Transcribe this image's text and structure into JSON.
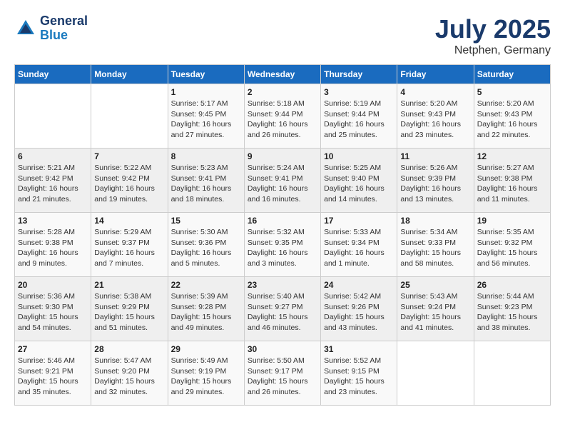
{
  "logo": {
    "line1": "General",
    "line2": "Blue"
  },
  "title": "July 2025",
  "subtitle": "Netphen, Germany",
  "days_header": [
    "Sunday",
    "Monday",
    "Tuesday",
    "Wednesday",
    "Thursday",
    "Friday",
    "Saturday"
  ],
  "weeks": [
    [
      {
        "day": "",
        "info": ""
      },
      {
        "day": "",
        "info": ""
      },
      {
        "day": "1",
        "info": "Sunrise: 5:17 AM\nSunset: 9:45 PM\nDaylight: 16 hours and 27 minutes."
      },
      {
        "day": "2",
        "info": "Sunrise: 5:18 AM\nSunset: 9:44 PM\nDaylight: 16 hours and 26 minutes."
      },
      {
        "day": "3",
        "info": "Sunrise: 5:19 AM\nSunset: 9:44 PM\nDaylight: 16 hours and 25 minutes."
      },
      {
        "day": "4",
        "info": "Sunrise: 5:20 AM\nSunset: 9:43 PM\nDaylight: 16 hours and 23 minutes."
      },
      {
        "day": "5",
        "info": "Sunrise: 5:20 AM\nSunset: 9:43 PM\nDaylight: 16 hours and 22 minutes."
      }
    ],
    [
      {
        "day": "6",
        "info": "Sunrise: 5:21 AM\nSunset: 9:42 PM\nDaylight: 16 hours and 21 minutes."
      },
      {
        "day": "7",
        "info": "Sunrise: 5:22 AM\nSunset: 9:42 PM\nDaylight: 16 hours and 19 minutes."
      },
      {
        "day": "8",
        "info": "Sunrise: 5:23 AM\nSunset: 9:41 PM\nDaylight: 16 hours and 18 minutes."
      },
      {
        "day": "9",
        "info": "Sunrise: 5:24 AM\nSunset: 9:41 PM\nDaylight: 16 hours and 16 minutes."
      },
      {
        "day": "10",
        "info": "Sunrise: 5:25 AM\nSunset: 9:40 PM\nDaylight: 16 hours and 14 minutes."
      },
      {
        "day": "11",
        "info": "Sunrise: 5:26 AM\nSunset: 9:39 PM\nDaylight: 16 hours and 13 minutes."
      },
      {
        "day": "12",
        "info": "Sunrise: 5:27 AM\nSunset: 9:38 PM\nDaylight: 16 hours and 11 minutes."
      }
    ],
    [
      {
        "day": "13",
        "info": "Sunrise: 5:28 AM\nSunset: 9:38 PM\nDaylight: 16 hours and 9 minutes."
      },
      {
        "day": "14",
        "info": "Sunrise: 5:29 AM\nSunset: 9:37 PM\nDaylight: 16 hours and 7 minutes."
      },
      {
        "day": "15",
        "info": "Sunrise: 5:30 AM\nSunset: 9:36 PM\nDaylight: 16 hours and 5 minutes."
      },
      {
        "day": "16",
        "info": "Sunrise: 5:32 AM\nSunset: 9:35 PM\nDaylight: 16 hours and 3 minutes."
      },
      {
        "day": "17",
        "info": "Sunrise: 5:33 AM\nSunset: 9:34 PM\nDaylight: 16 hours and 1 minute."
      },
      {
        "day": "18",
        "info": "Sunrise: 5:34 AM\nSunset: 9:33 PM\nDaylight: 15 hours and 58 minutes."
      },
      {
        "day": "19",
        "info": "Sunrise: 5:35 AM\nSunset: 9:32 PM\nDaylight: 15 hours and 56 minutes."
      }
    ],
    [
      {
        "day": "20",
        "info": "Sunrise: 5:36 AM\nSunset: 9:30 PM\nDaylight: 15 hours and 54 minutes."
      },
      {
        "day": "21",
        "info": "Sunrise: 5:38 AM\nSunset: 9:29 PM\nDaylight: 15 hours and 51 minutes."
      },
      {
        "day": "22",
        "info": "Sunrise: 5:39 AM\nSunset: 9:28 PM\nDaylight: 15 hours and 49 minutes."
      },
      {
        "day": "23",
        "info": "Sunrise: 5:40 AM\nSunset: 9:27 PM\nDaylight: 15 hours and 46 minutes."
      },
      {
        "day": "24",
        "info": "Sunrise: 5:42 AM\nSunset: 9:26 PM\nDaylight: 15 hours and 43 minutes."
      },
      {
        "day": "25",
        "info": "Sunrise: 5:43 AM\nSunset: 9:24 PM\nDaylight: 15 hours and 41 minutes."
      },
      {
        "day": "26",
        "info": "Sunrise: 5:44 AM\nSunset: 9:23 PM\nDaylight: 15 hours and 38 minutes."
      }
    ],
    [
      {
        "day": "27",
        "info": "Sunrise: 5:46 AM\nSunset: 9:21 PM\nDaylight: 15 hours and 35 minutes."
      },
      {
        "day": "28",
        "info": "Sunrise: 5:47 AM\nSunset: 9:20 PM\nDaylight: 15 hours and 32 minutes."
      },
      {
        "day": "29",
        "info": "Sunrise: 5:49 AM\nSunset: 9:19 PM\nDaylight: 15 hours and 29 minutes."
      },
      {
        "day": "30",
        "info": "Sunrise: 5:50 AM\nSunset: 9:17 PM\nDaylight: 15 hours and 26 minutes."
      },
      {
        "day": "31",
        "info": "Sunrise: 5:52 AM\nSunset: 9:15 PM\nDaylight: 15 hours and 23 minutes."
      },
      {
        "day": "",
        "info": ""
      },
      {
        "day": "",
        "info": ""
      }
    ]
  ]
}
